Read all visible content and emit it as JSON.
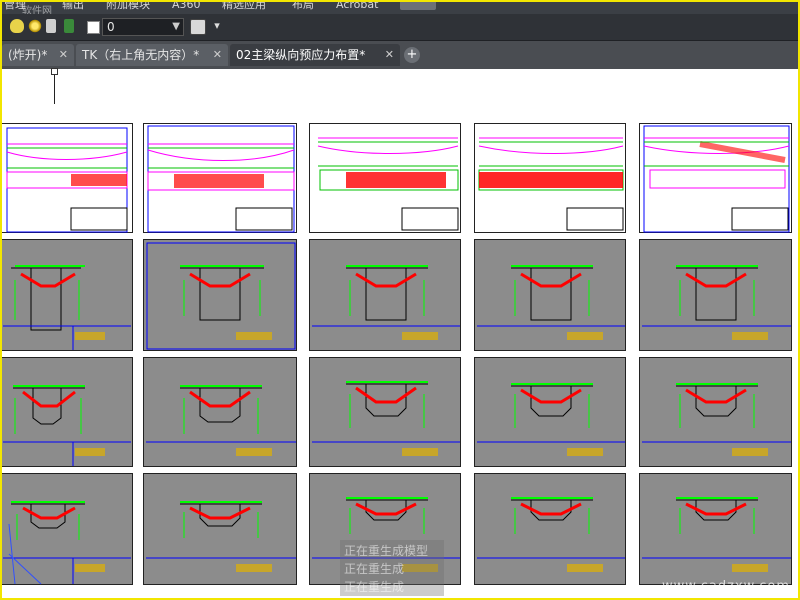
{
  "ribbon": {
    "tabs": [
      "管理",
      "输出",
      "附加模块",
      "A360",
      "精选应用",
      "布局",
      "Acrobat"
    ]
  },
  "toolbar": {
    "layer_value": "0",
    "icons": [
      "lightbulb-icon",
      "sun-icon",
      "lock-icon",
      "color-swatch-icon",
      "dropdown-icon",
      "layer-props-icon",
      "menu-icon"
    ]
  },
  "tabs": [
    {
      "label": "(炸开)*",
      "active": false
    },
    {
      "label": "TK（右上角无内容）*",
      "active": false
    },
    {
      "label": "02主梁纵向预应力布置*",
      "active": true
    }
  ],
  "tab_add": "+",
  "status_lines": [
    "正在重生成模型",
    "正在重生成",
    "正在重生成"
  ],
  "watermark": "www.cadzxw.com",
  "logo_text": "软件网",
  "colors": {
    "accent_frame": "#f2e600",
    "sheet_grey": "#8c8c8c",
    "cad_green": "#00ff00",
    "cad_red": "#ff0000",
    "cad_magenta": "#ff00ff",
    "cad_blue": "#0000ff"
  }
}
